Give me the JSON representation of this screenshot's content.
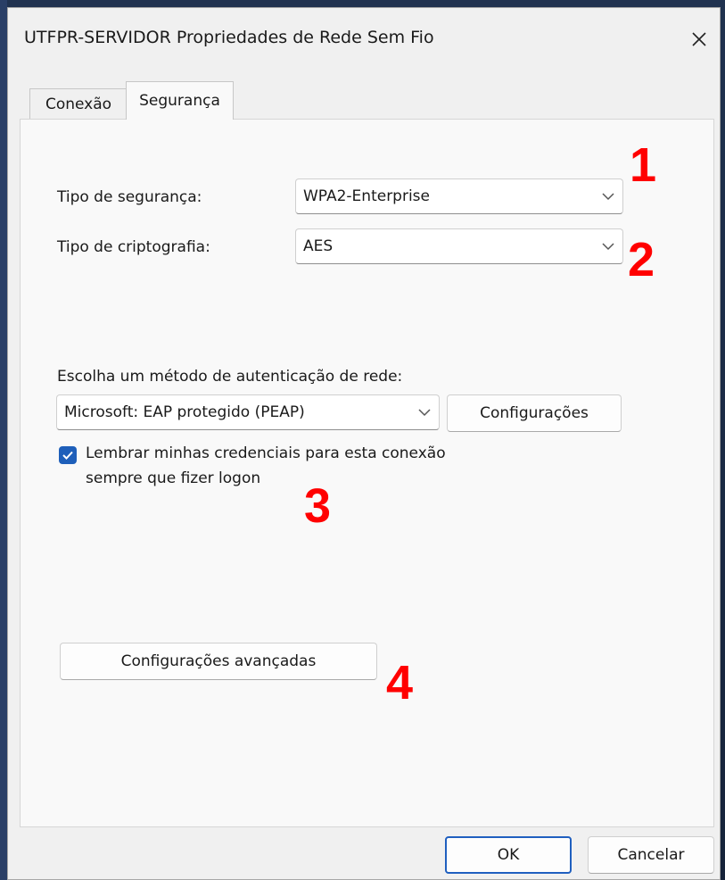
{
  "window": {
    "title": "UTFPR-SERVIDOR Propriedades de Rede Sem Fio",
    "close_icon": "close-icon"
  },
  "tabs": [
    {
      "label": "Conexão",
      "selected": false
    },
    {
      "label": "Segurança",
      "selected": true
    }
  ],
  "security": {
    "security_type_label": "Tipo de segurança:",
    "security_type_value": "WPA2-Enterprise",
    "encryption_type_label": "Tipo de criptografia:",
    "encryption_type_value": "AES",
    "auth_method_label": "Escolha um método de autenticação de rede:",
    "auth_method_value": "Microsoft: EAP protegido (PEAP)",
    "settings_button": "Configurações",
    "remember_checked": true,
    "remember_line1": "Lembrar minhas credenciais para esta conexão",
    "remember_line2": "sempre que fizer logon",
    "advanced_button": "Configurações avançadas"
  },
  "footer": {
    "ok_label": "OK",
    "cancel_label": "Cancelar"
  },
  "annotations": [
    "1",
    "2",
    "3",
    "4"
  ],
  "colors": {
    "accent": "#1e5fba",
    "annotation": "#ff0000"
  }
}
